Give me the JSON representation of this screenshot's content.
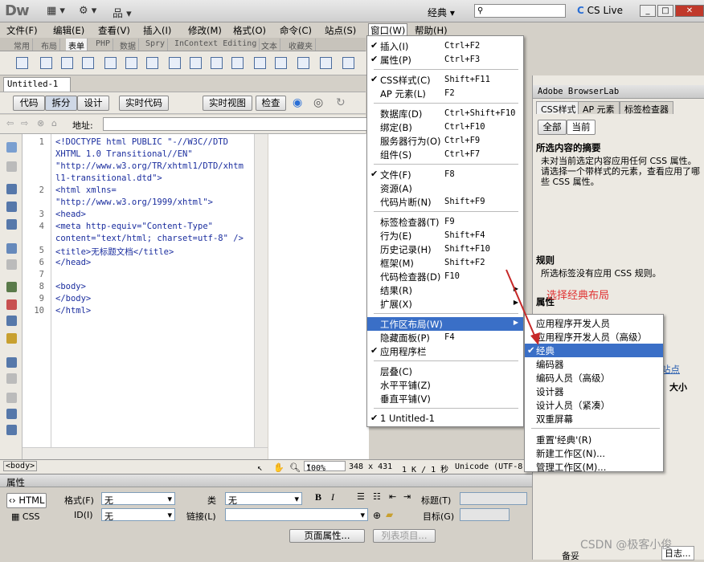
{
  "app": {
    "logo": "Dw",
    "workspace": "经典",
    "cslive": "CS Live"
  },
  "menubar": [
    "文件(F)",
    "编辑(E)",
    "查看(V)",
    "插入(I)",
    "修改(M)",
    "格式(O)",
    "命令(C)",
    "站点(S)",
    "窗口(W)",
    "帮助(H)"
  ],
  "insert_tabs": [
    "常用",
    "布局",
    "表单",
    "PHP",
    "数据",
    "Spry",
    "InContext Editing",
    "文本",
    "收藏夹"
  ],
  "doc": {
    "tab": "Untitled-1",
    "views": [
      "代码",
      "拆分",
      "设计"
    ],
    "live_code": "实时代码",
    "live_view": "实时视图",
    "inspect": "检查",
    "address_label": "地址:"
  },
  "code_lines": [
    {
      "n": "1",
      "t": "<!DOCTYPE html PUBLIC \"-//W3C//DTD"
    },
    {
      "n": "",
      "t": "XHTML 1.0 Transitional//EN\""
    },
    {
      "n": "",
      "t": "\"http://www.w3.org/TR/xhtml1/DTD/xhtm"
    },
    {
      "n": "",
      "t": "l1-transitional.dtd\">"
    },
    {
      "n": "2",
      "t": "<html xmlns="
    },
    {
      "n": "",
      "t": "\"http://www.w3.org/1999/xhtml\">"
    },
    {
      "n": "3",
      "t": "<head>"
    },
    {
      "n": "4",
      "t": "<meta http-equiv=\"Content-Type\""
    },
    {
      "n": "",
      "t": "content=\"text/html; charset=utf-8\" />"
    },
    {
      "n": "5",
      "t": "<title>无标题文档</title>"
    },
    {
      "n": "6",
      "t": "</head>"
    },
    {
      "n": "7",
      "t": ""
    },
    {
      "n": "8",
      "t": "<body>"
    },
    {
      "n": "9",
      "t": "</body>"
    },
    {
      "n": "10",
      "t": "</html>"
    }
  ],
  "status": {
    "tag": "<body>",
    "zoom": "100%",
    "size": "348 x 431",
    "dl": "1 K / 1 秒",
    "enc": "Unicode (UTF-8"
  },
  "props": {
    "title": "属性",
    "html": "HTML",
    "css": "CSS",
    "format_label": "格式(F)",
    "format_val": "无",
    "class_label": "类",
    "class_val": "无",
    "id_label": "ID(I)",
    "id_val": "无",
    "link_label": "链接(L)",
    "title_label": "标题(T)",
    "target_label": "目标(G)",
    "page_props": "页面属性...",
    "list_item": "列表项目..."
  },
  "window_menu": [
    {
      "check": "✔",
      "l": "插入(I)",
      "s": "Ctrl+F2"
    },
    {
      "check": "✔",
      "l": "属性(P)",
      "s": "Ctrl+F3"
    },
    {
      "sep": true
    },
    {
      "check": "✔",
      "l": "CSS样式(C)",
      "s": "Shift+F11"
    },
    {
      "check": "",
      "l": "AP 元素(L)",
      "s": "F2"
    },
    {
      "sep": true
    },
    {
      "check": "",
      "l": "数据库(D)",
      "s": "Ctrl+Shift+F10"
    },
    {
      "check": "",
      "l": "绑定(B)",
      "s": "Ctrl+F10"
    },
    {
      "check": "",
      "l": "服务器行为(O)",
      "s": "Ctrl+F9"
    },
    {
      "check": "",
      "l": "组件(S)",
      "s": "Ctrl+F7"
    },
    {
      "sep": true
    },
    {
      "check": "✔",
      "l": "文件(F)",
      "s": "F8"
    },
    {
      "check": "",
      "l": "资源(A)",
      "s": ""
    },
    {
      "check": "",
      "l": "代码片断(N)",
      "s": "Shift+F9"
    },
    {
      "sep": true
    },
    {
      "check": "",
      "l": "标签检查器(T)",
      "s": "F9"
    },
    {
      "check": "",
      "l": "行为(E)",
      "s": "Shift+F4"
    },
    {
      "check": "",
      "l": "历史记录(H)",
      "s": "Shift+F10"
    },
    {
      "check": "",
      "l": "框架(M)",
      "s": "Shift+F2"
    },
    {
      "check": "",
      "l": "代码检查器(D)",
      "s": "F10"
    },
    {
      "check": "",
      "l": "结果(R)",
      "s": "",
      "arrow": true
    },
    {
      "check": "",
      "l": "扩展(X)",
      "s": "",
      "arrow": true
    },
    {
      "sep": true
    },
    {
      "check": "",
      "l": "工作区布局(W)",
      "s": "",
      "arrow": true,
      "sel": true
    },
    {
      "check": "",
      "l": "隐藏面板(P)",
      "s": "F4"
    },
    {
      "check": "✔",
      "l": "应用程序栏",
      "s": ""
    },
    {
      "sep": true
    },
    {
      "check": "",
      "l": "层叠(C)",
      "s": ""
    },
    {
      "check": "",
      "l": "水平平铺(Z)",
      "s": ""
    },
    {
      "check": "",
      "l": "垂直平铺(V)",
      "s": ""
    },
    {
      "sep": true
    },
    {
      "check": "✔",
      "l": "1 Untitled-1",
      "s": ""
    }
  ],
  "layout_submenu": [
    {
      "c": "",
      "l": "应用程序开发人员"
    },
    {
      "c": "",
      "l": "应用程序开发人员（高级）"
    },
    {
      "c": "✔",
      "l": "经典",
      "sel": true
    },
    {
      "c": "",
      "l": "编码器"
    },
    {
      "c": "",
      "l": "编码人员（高级）"
    },
    {
      "c": "",
      "l": "设计器"
    },
    {
      "c": "",
      "l": "设计人员（紧凑）"
    },
    {
      "c": "",
      "l": "双重屏幕"
    },
    {
      "sep": true
    },
    {
      "c": "",
      "l": "重置'经典'(R)"
    },
    {
      "c": "",
      "l": "新建工作区(N)..."
    },
    {
      "c": "",
      "l": "管理工作区(M)..."
    }
  ],
  "right": {
    "browserlab": "Adobe BrowserLab",
    "tabs": [
      "CSS样式",
      "AP 元素",
      "标签检查器"
    ],
    "all": "全部",
    "current": "当前",
    "summary_title": "所选内容的摘要",
    "summary_text": "未对当前选定内容应用任何 CSS 属性。请选择一个带样式的元素，查看应用了哪些 CSS 属性。",
    "rules_title": "规则",
    "rules_text": "所选标签没有应用 CSS 规则。",
    "props_title": "属性",
    "site": "站点",
    "size_col": "大小",
    "backup": "备妥",
    "log": "日志..."
  },
  "annotation": "选择经典布局",
  "watermark": "CSDN @极客小俊",
  "colors": {
    "menu_highlight": "#3a6fc7",
    "annotation": "#e03333",
    "code_tag": "#1a2d9e"
  }
}
